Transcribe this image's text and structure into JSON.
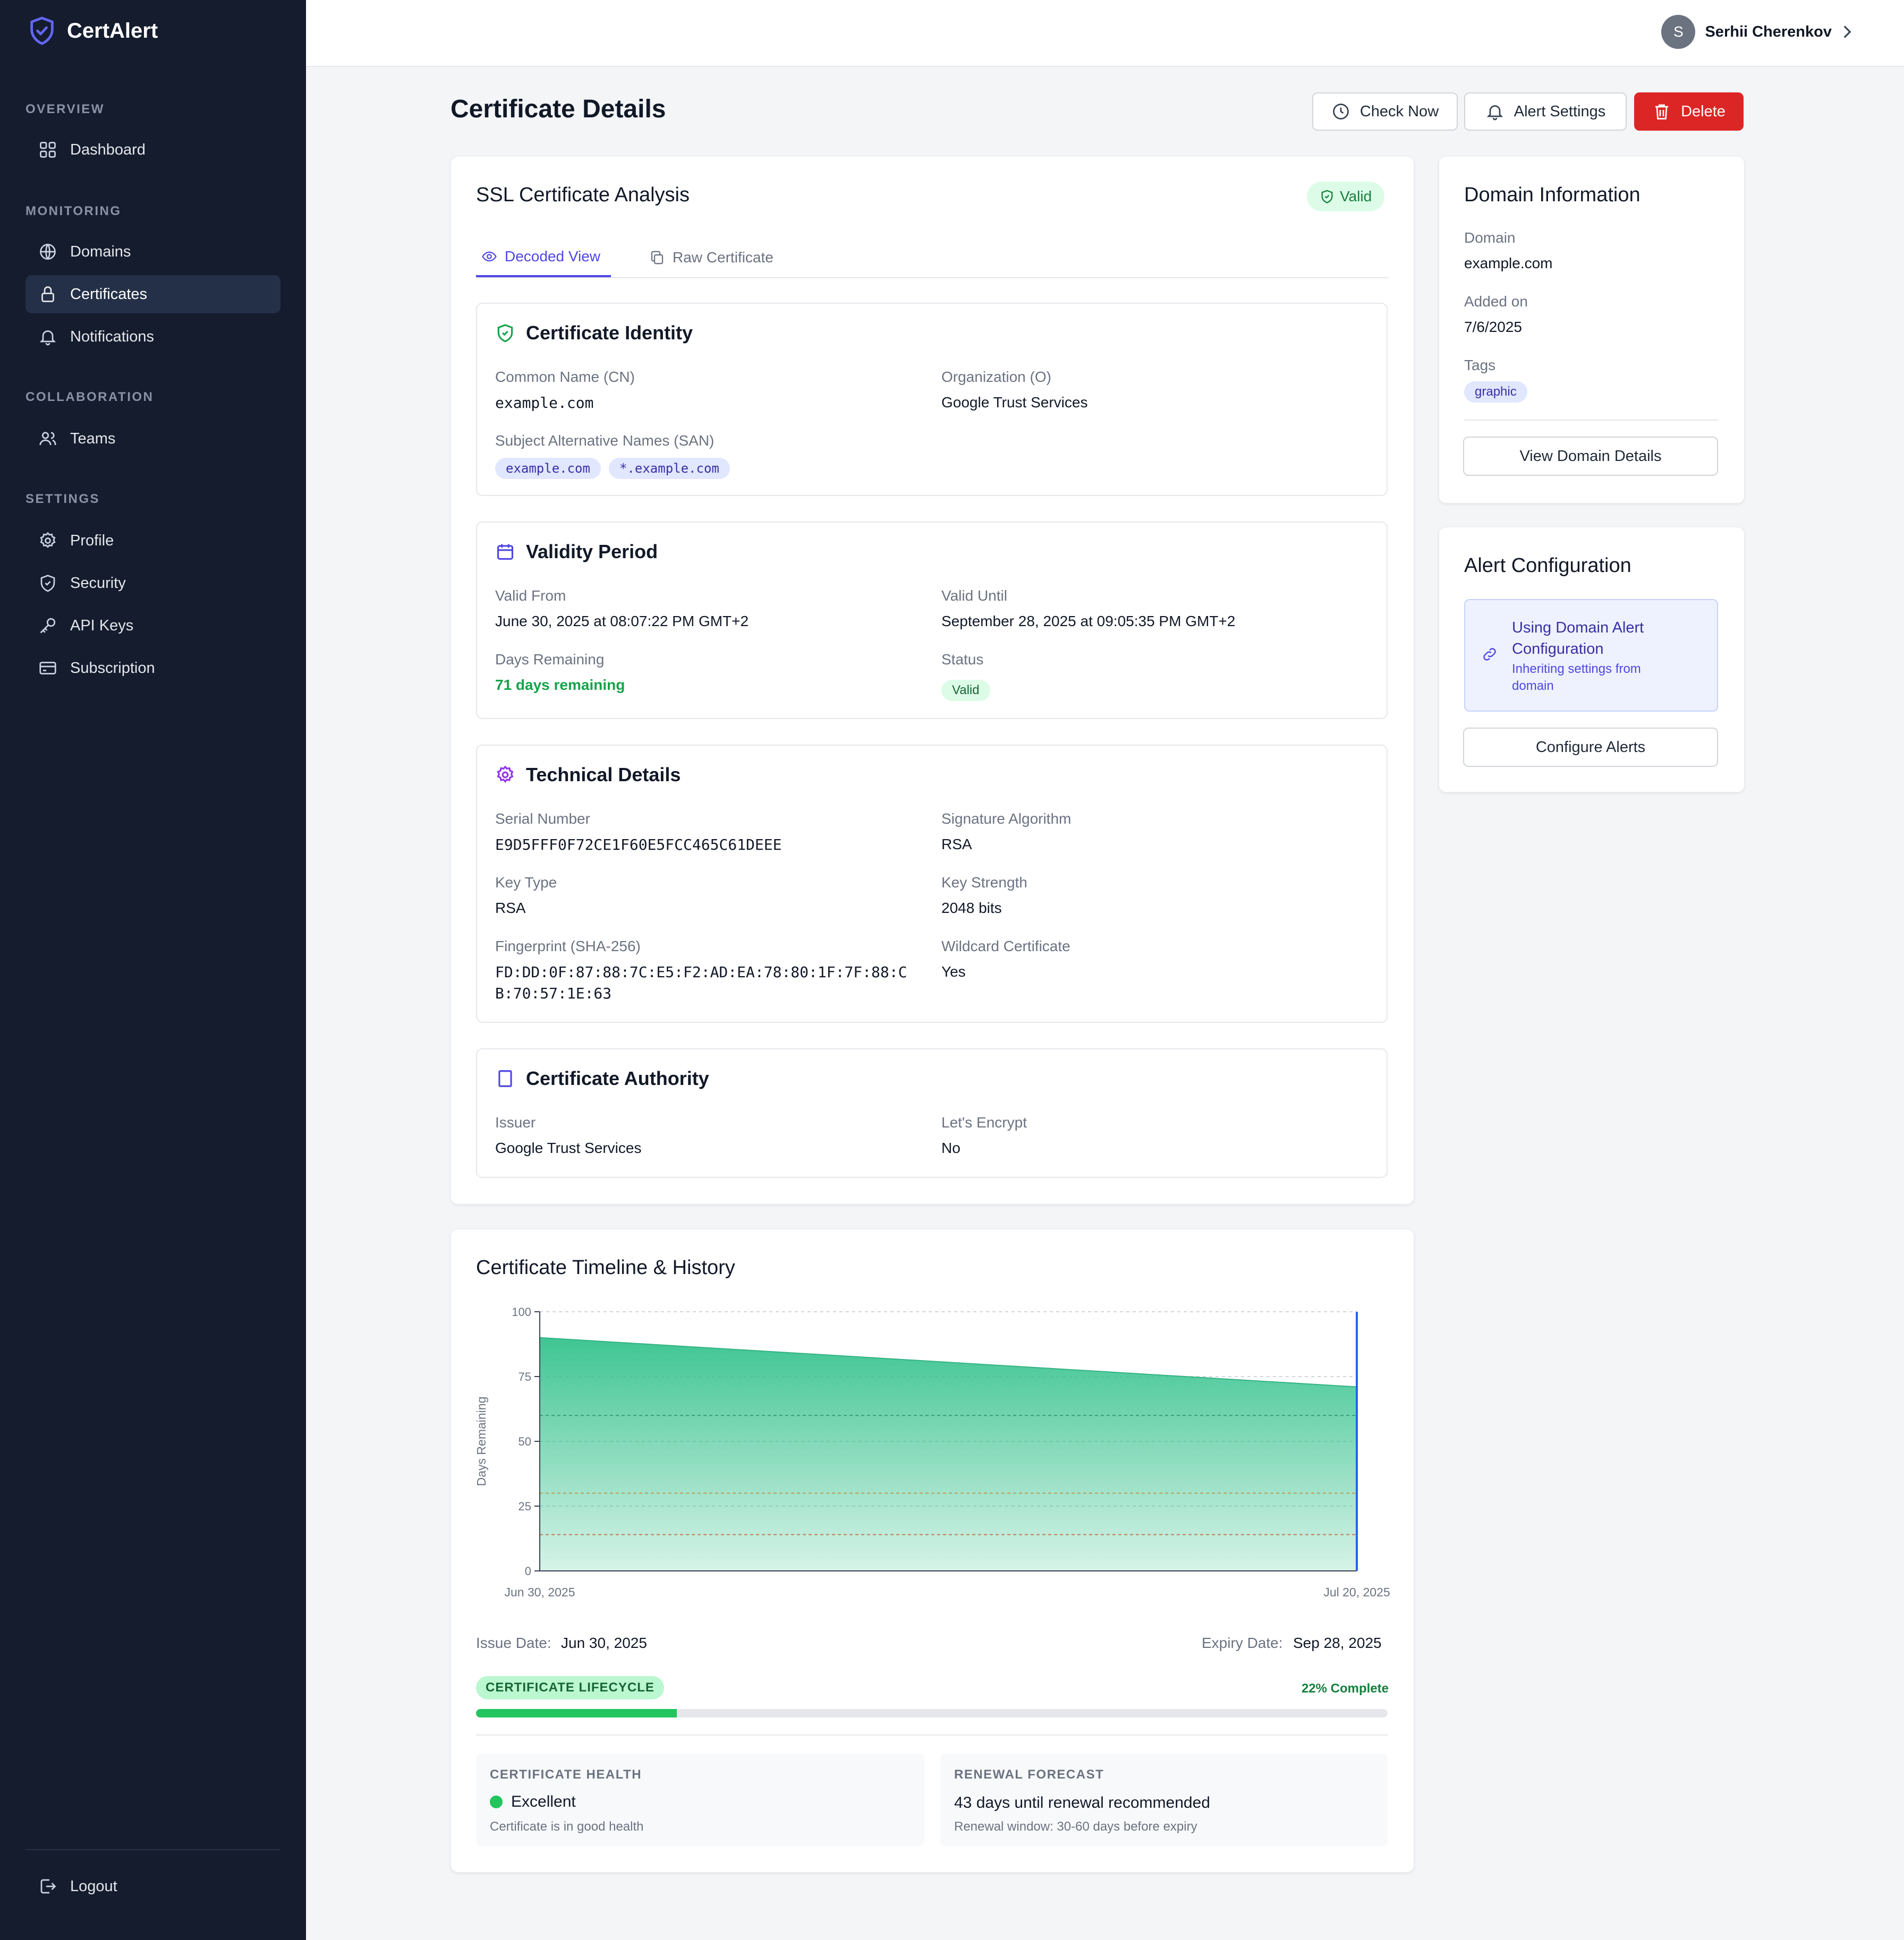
{
  "brand": {
    "name": "CertAlert",
    "accent": "#4f46e5"
  },
  "sidebar": {
    "sections": [
      {
        "title": "OVERVIEW",
        "items": [
          {
            "label": "Dashboard",
            "icon": "dashboard-icon"
          }
        ]
      },
      {
        "title": "MONITORING",
        "items": [
          {
            "label": "Domains",
            "icon": "globe-icon"
          },
          {
            "label": "Certificates",
            "icon": "lock-icon",
            "active": true
          },
          {
            "label": "Notifications",
            "icon": "bell-icon"
          }
        ]
      },
      {
        "title": "COLLABORATION",
        "items": [
          {
            "label": "Teams",
            "icon": "users-icon"
          }
        ]
      },
      {
        "title": "SETTINGS",
        "items": [
          {
            "label": "Profile",
            "icon": "gear-icon"
          },
          {
            "label": "Security",
            "icon": "shield-icon"
          },
          {
            "label": "API Keys",
            "icon": "key-icon"
          },
          {
            "label": "Subscription",
            "icon": "credit-card-icon"
          }
        ]
      }
    ],
    "logout": "Logout"
  },
  "user": {
    "initial": "S",
    "name": "Serhii Cherenkov"
  },
  "page": {
    "title": "Certificate Details",
    "actions": {
      "check_now": "Check Now",
      "alert_settings": "Alert Settings",
      "delete": "Delete"
    }
  },
  "analysis": {
    "title": "SSL Certificate Analysis",
    "status": "Valid",
    "tabs": {
      "decoded": "Decoded View",
      "raw": "Raw Certificate"
    },
    "identity": {
      "title": "Certificate Identity",
      "cn_label": "Common Name (CN)",
      "cn": "example.com",
      "org_label": "Organization (O)",
      "org": "Google Trust Services",
      "san_label": "Subject Alternative Names (SAN)",
      "san": [
        "example.com",
        "*.example.com"
      ]
    },
    "validity": {
      "title": "Validity Period",
      "from_label": "Valid From",
      "from": "June 30, 2025 at 08:07:22 PM GMT+2",
      "until_label": "Valid Until",
      "until": "September 28, 2025 at 09:05:35 PM GMT+2",
      "remaining_label": "Days Remaining",
      "remaining": "71 days remaining",
      "status_label": "Status",
      "status": "Valid"
    },
    "technical": {
      "title": "Technical Details",
      "serial_label": "Serial Number",
      "serial": "E9D5FFF0F72CE1F60E5FCC465C61DEEE",
      "sig_label": "Signature Algorithm",
      "sig": "RSA",
      "keytype_label": "Key Type",
      "keytype": "RSA",
      "strength_label": "Key Strength",
      "strength": "2048 bits",
      "fp_label": "Fingerprint (SHA-256)",
      "fp_line1": "FD:DD:0F:87:88:7C:E5:F2:AD:EA:78:80:1F:7F:88:C",
      "fp_line2": "B:70:57:1E:63",
      "wildcard_label": "Wildcard Certificate",
      "wildcard": "Yes"
    },
    "authority": {
      "title": "Certificate Authority",
      "issuer_label": "Issuer",
      "issuer": "Google Trust Services",
      "le_label": "Let's Encrypt",
      "le": "No"
    }
  },
  "domain_info": {
    "title": "Domain Information",
    "domain_label": "Domain",
    "domain": "example.com",
    "added_label": "Added on",
    "added": "7/6/2025",
    "tags_label": "Tags",
    "tags": [
      "graphic"
    ],
    "view_button": "View Domain Details"
  },
  "alert_config": {
    "title": "Alert Configuration",
    "using_title": "Using Domain Alert Configuration",
    "inheriting": "Inheriting settings from domain",
    "configure_button": "Configure Alerts"
  },
  "timeline": {
    "title": "Certificate Timeline & History",
    "issue_label": "Issue Date:",
    "issue": "Jun 30, 2025",
    "expiry_label": "Expiry Date:",
    "expiry": "Sep 28, 2025",
    "lifecycle_label": "CERTIFICATE LIFECYCLE",
    "complete": "22% Complete",
    "progress_fraction": 0.22,
    "health_title": "CERTIFICATE HEALTH",
    "health": "Excellent",
    "health_note": "Certificate is in good health",
    "forecast_title": "RENEWAL FORECAST",
    "forecast": "43 days until renewal recommended",
    "forecast_note": "Renewal window: 30-60 days before expiry"
  },
  "chart_data": {
    "type": "area",
    "title": "",
    "xlabel": "",
    "ylabel": "Days Remaining",
    "x": [
      "2025-06-30",
      "2025-07-20"
    ],
    "x_tick_labels": [
      "Jun 30, 2025",
      "Jul 20, 2025"
    ],
    "series": [
      {
        "values": [
          90,
          71
        ]
      }
    ],
    "ylim": [
      0,
      100
    ],
    "yticks": [
      0,
      25,
      50,
      75,
      100
    ],
    "thresholds": [
      60,
      30,
      14
    ],
    "current_marker_x": "2025-07-20",
    "color": "#10b981"
  }
}
